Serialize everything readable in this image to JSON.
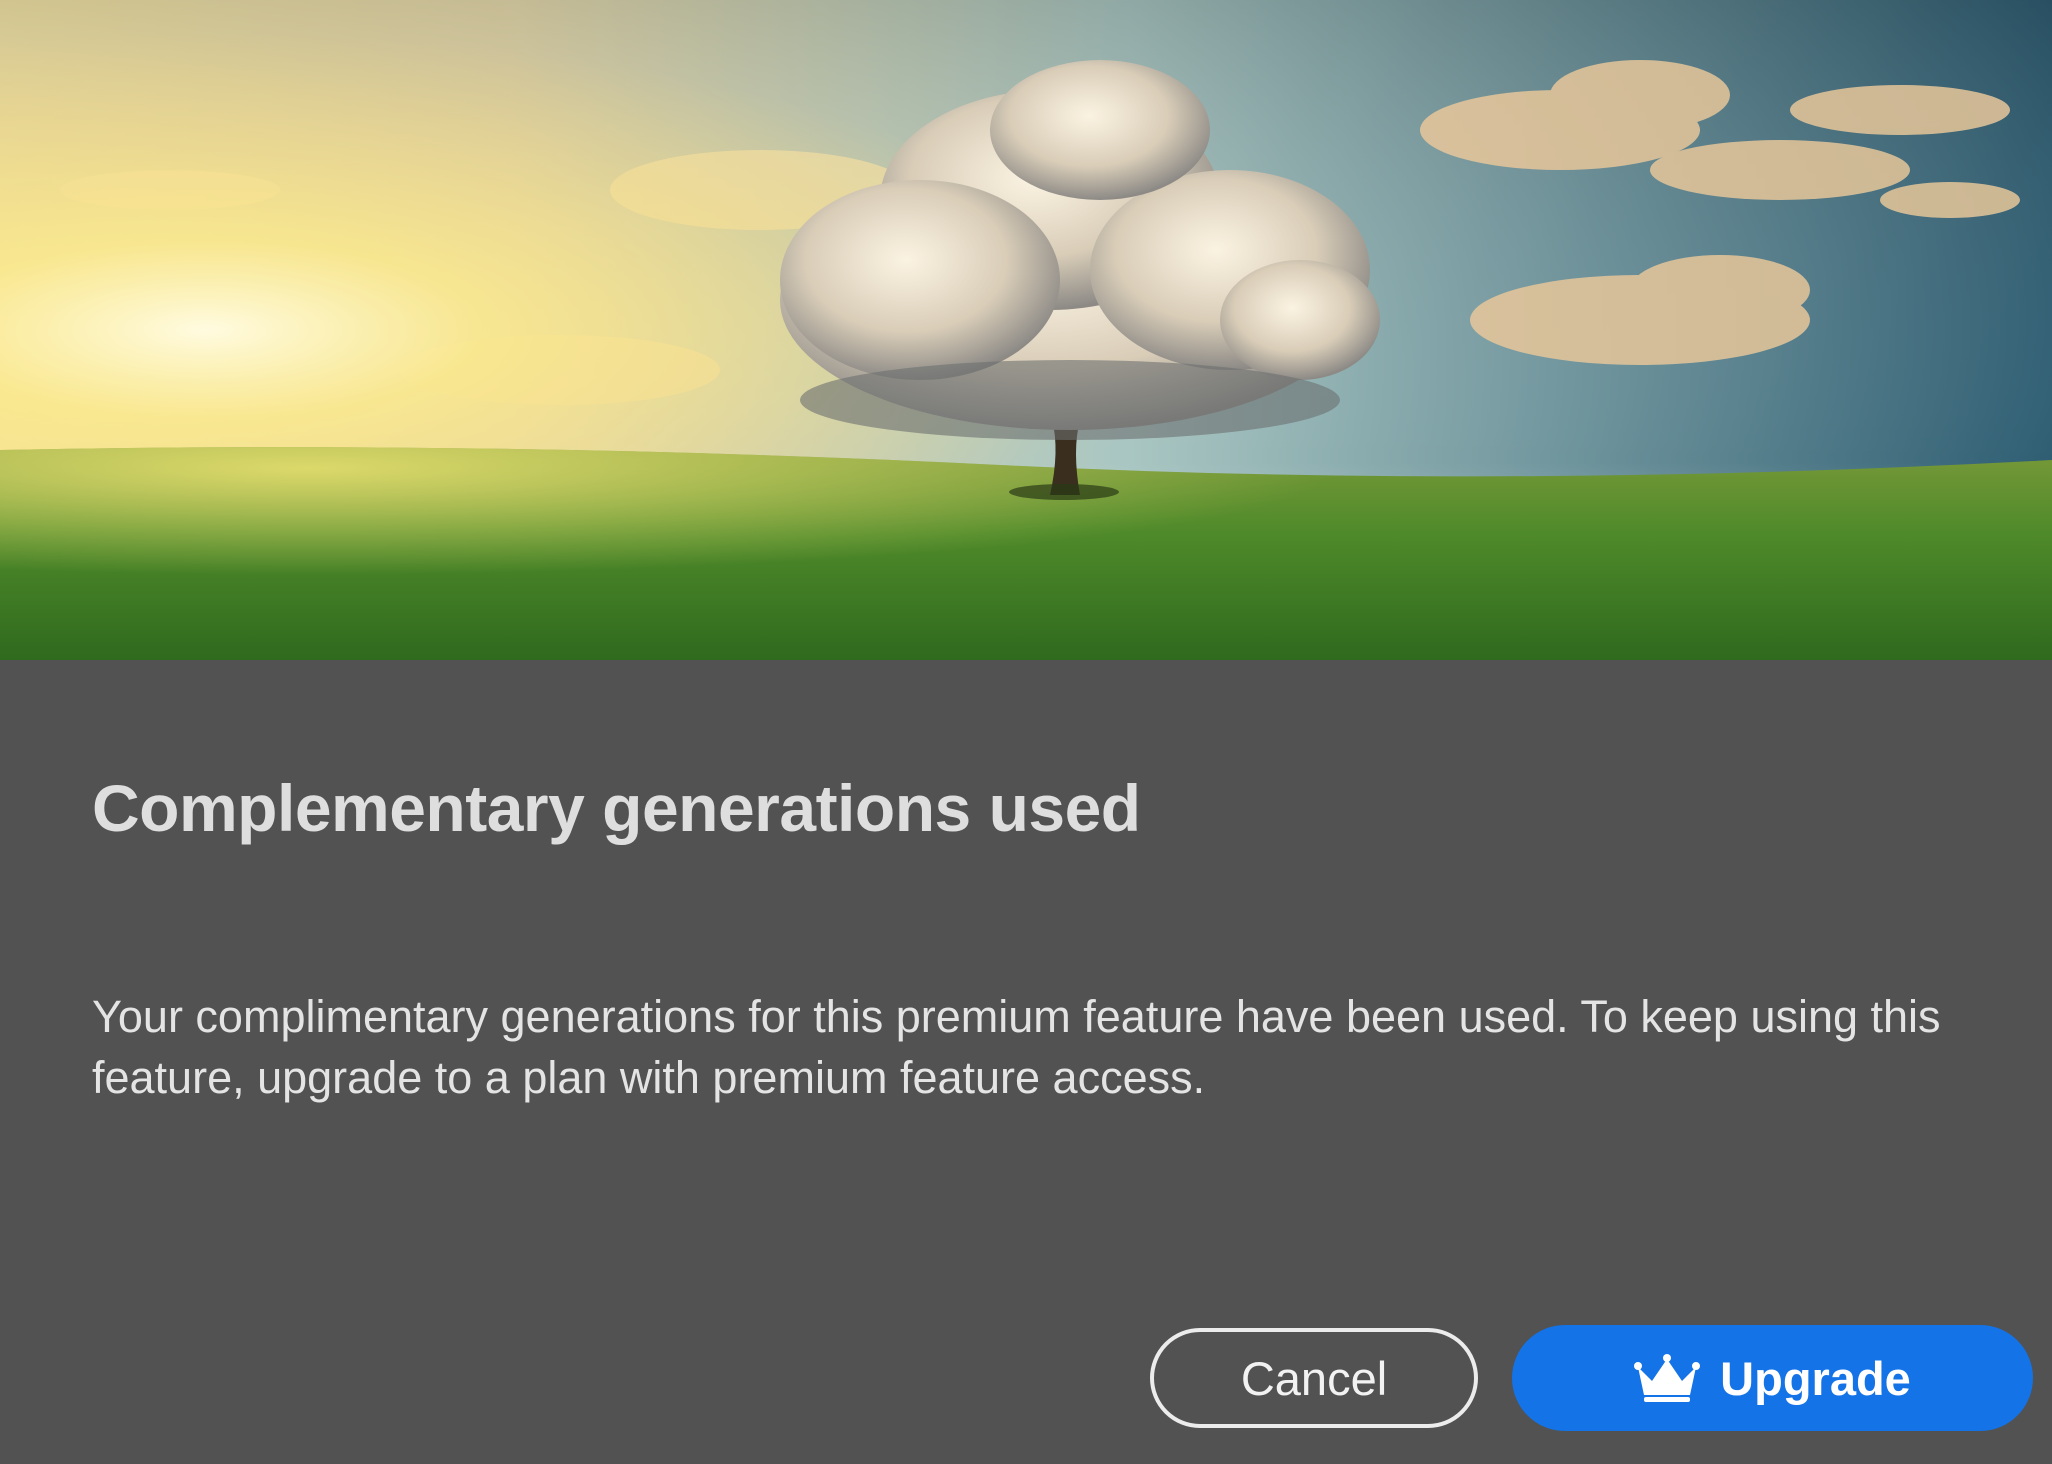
{
  "dialog": {
    "title": "Complementary generations used",
    "message": "Your complimentary generations for this premium feature have been used. To keep using this feature, upgrade to a plan with premium feature access.",
    "hero_image": "cloud-tree-landscape",
    "buttons": {
      "cancel_label": "Cancel",
      "upgrade_label": "Upgrade",
      "upgrade_icon": "crown-icon"
    },
    "colors": {
      "background": "#525252",
      "primary_button": "#1473e6"
    }
  }
}
